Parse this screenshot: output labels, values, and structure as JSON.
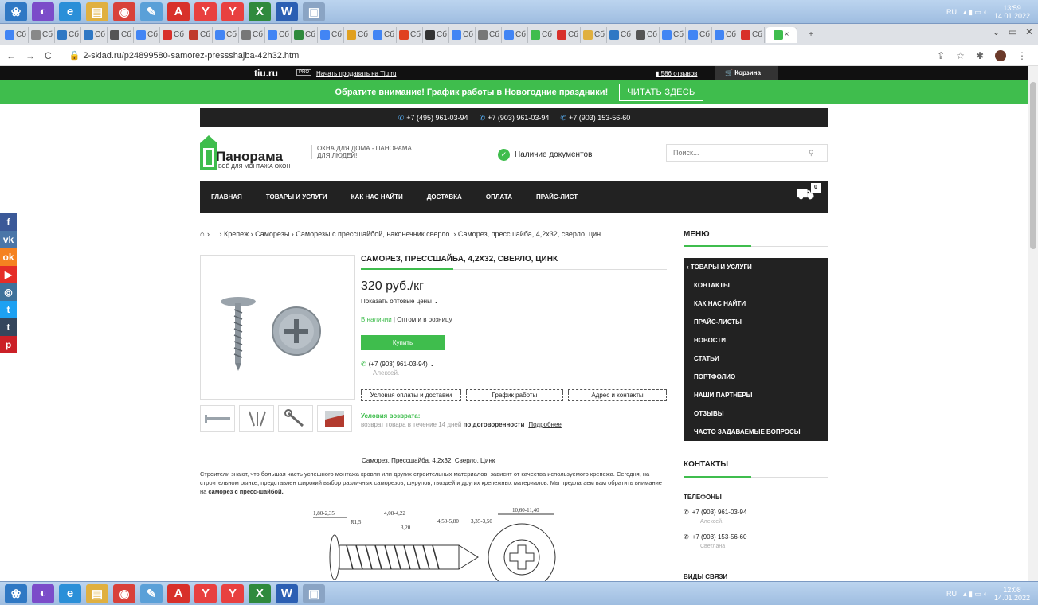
{
  "taskbar": {
    "apps": [
      {
        "name": "start-orb-icon",
        "color": "#2f78c4",
        "glyph": "❀"
      },
      {
        "name": "app-launcher-icon",
        "color": "#7b4cc9",
        "glyph": "◐"
      },
      {
        "name": "ie-icon",
        "color": "#2a8fd8",
        "glyph": "e"
      },
      {
        "name": "folder-icon",
        "color": "#e0b040",
        "glyph": "▤"
      },
      {
        "name": "chrome-icon",
        "color": "#d8413a",
        "glyph": "◉"
      },
      {
        "name": "tool-icon",
        "color": "#5aa0d8",
        "glyph": "✎"
      },
      {
        "name": "acrobat-icon",
        "color": "#d8302a",
        "glyph": "A"
      },
      {
        "name": "yandex-icon",
        "color": "#e84040",
        "glyph": "Y"
      },
      {
        "name": "yandex-browser-icon",
        "color": "#e84040",
        "glyph": "Y"
      },
      {
        "name": "excel-icon",
        "color": "#2f8a3d",
        "glyph": "X"
      },
      {
        "name": "word-icon",
        "color": "#2b5fb3",
        "glyph": "W"
      },
      {
        "name": "window-icon",
        "color": "#8aa4c4",
        "glyph": "▣"
      }
    ],
    "top_clock_time": "13:59",
    "top_clock_date": "14.01.2022",
    "bottom_clock_time": "12:08",
    "bottom_clock_date": "14.01.2022",
    "lang": "RU"
  },
  "browser": {
    "url": "2-sklad.ru/p24899580-samorez-pressshajba-42h32.html",
    "tab_label": "Сб",
    "new_tab": "+"
  },
  "tiu": {
    "logo": "tiu.ru",
    "pro": "PRO",
    "sell_link": "Начать продавать на Tiu.ru",
    "reviews": "586 отзывов",
    "cart": "Корзина"
  },
  "notice": {
    "text": "Обратите внимание! График работы в Новогодние праздники!",
    "button": "ЧИТАТЬ ЗДЕСЬ"
  },
  "phones_bar": [
    "+7 (495) 961-03-94",
    "+7 (903) 961-03-94",
    "+7 (903) 153-56-60"
  ],
  "header": {
    "logo_name": "Панорама",
    "logo_sub": "ВСЁ ДЛЯ МОНТАЖА ОКОН",
    "tagline_1": "ОКНА ДЛЯ ДОМА - ПАНОРАМА",
    "tagline_2": "ДЛЯ ЛЮДЕЙ!",
    "docs": "Наличие документов",
    "search_placeholder": "Поиск..."
  },
  "nav": {
    "items": [
      "ГЛАВНАЯ",
      "ТОВАРЫ И УСЛУГИ",
      "КАК НАС НАЙТИ",
      "ДОСТАВКА",
      "ОПЛАТА",
      "ПРАЙС-ЛИСТ"
    ],
    "cart_count": "0"
  },
  "social": [
    {
      "name": "facebook-icon",
      "color": "#3b5998",
      "glyph": "f"
    },
    {
      "name": "vk-icon",
      "color": "#4a76a8",
      "glyph": "vk"
    },
    {
      "name": "odnoklassniki-icon",
      "color": "#f58220",
      "glyph": "ok"
    },
    {
      "name": "youtube-icon",
      "color": "#e52d27",
      "glyph": "▶"
    },
    {
      "name": "instagram-icon",
      "color": "#3f729b",
      "glyph": "◎"
    },
    {
      "name": "twitter-icon",
      "color": "#1da1f2",
      "glyph": "t"
    },
    {
      "name": "tumblr-icon",
      "color": "#35465c",
      "glyph": "t"
    },
    {
      "name": "pinterest-icon",
      "color": "#cb2027",
      "glyph": "p"
    }
  ],
  "breadcrumb": "› ... › Крепеж › Саморезы › Саморезы с прессшайбой, наконечник сверло. › Саморез, прессшайба, 4,2х32, сверло, цин",
  "product": {
    "title": "САМОРЕЗ, ПРЕССШАЙБА, 4,2Х32, СВЕРЛО, ЦИНК",
    "price": "320 руб./кг",
    "wholesale": "Показать оптовые цены",
    "in_stock": "В наличии",
    "stock_rest": "| Оптом и в розницу",
    "buy": "Купить",
    "phone": "(+7 (903) 961-03-94)",
    "person": "Алексей.",
    "btn_payment": "Условия оплаты и доставки",
    "btn_schedule": "График работы",
    "btn_address": "Адрес и контакты",
    "return_title": "Условия возврата:",
    "return_text": "возврат товара в течение 14 дней",
    "return_bold": "по договоренности",
    "return_more": "Подробнее"
  },
  "menu": {
    "title": "МЕНЮ",
    "items": [
      "‹ ТОВАРЫ И УСЛУГИ",
      "КОНТАКТЫ",
      "КАК НАС НАЙТИ",
      "ПРАЙС-ЛИСТЫ",
      "НОВОСТИ",
      "СТАТЬИ",
      "ПОРТФОЛИО",
      "НАШИ ПАРТНЁРЫ",
      "ОТЗЫВЫ",
      "ЧАСТО ЗАДАВАЕМЫЕ ВОПРОСЫ"
    ]
  },
  "description": {
    "title": "Саморез, Прессшайба, 4,2х32, Сверло, Цинк",
    "text": "Строители знают, что большая часть успешного монтажа кровли или других строительных материалов, зависит от качества используемого крепежа. Сегодня, на строительном рынке, представлен широкий выбор различных саморезов, шурупов, гвоздей и других крепежных материалов. Мы предлагаем вам обратить внимание на",
    "bold": "саморез с пресс-шайбой.",
    "dims": [
      "1,80-2,35",
      "R1,5",
      "4,08-4,22",
      "3,20",
      "4,50-5,80",
      "3,35-3,50",
      "10,60-11,40"
    ]
  },
  "contacts": {
    "title": "КОНТАКТЫ",
    "phones_label": "ТЕЛЕФОНЫ",
    "phone1": "+7 (903) 961-03-94",
    "name1": "Алексей.",
    "phone2": "+7 (903) 153-56-60",
    "name2": "Светлана",
    "vidy": "ВИДЫ СВЯЗИ"
  }
}
